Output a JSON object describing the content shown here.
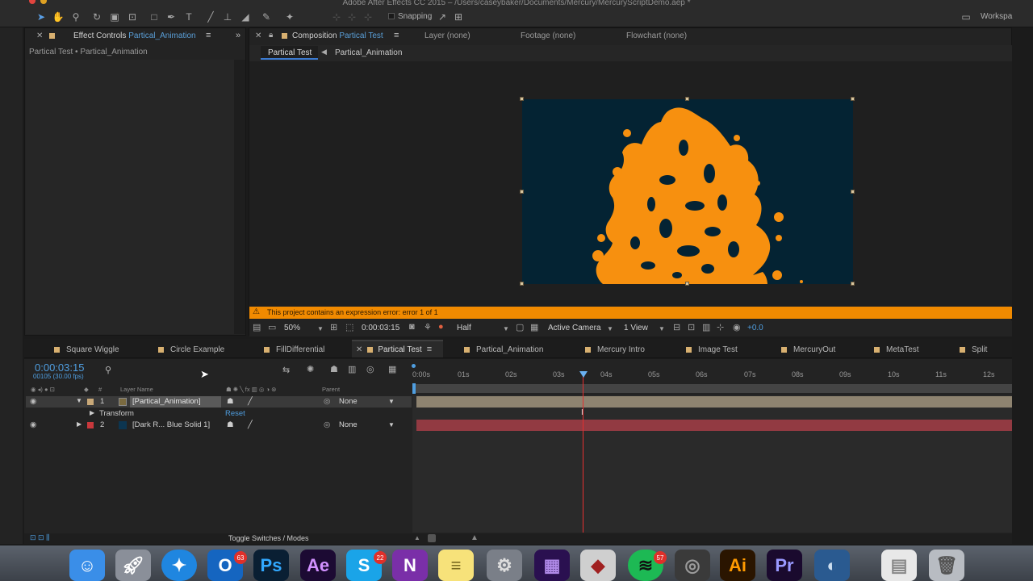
{
  "window": {
    "title": "Adobe After Effects CC 2015 – /Users/caseybaker/Documents/Mercury/MercuryScriptDemo.aep *"
  },
  "toolbar": {
    "tools": [
      "selection-tool",
      "hand-tool",
      "zoom-tool",
      "rotation-tool",
      "camera-tool",
      "behind-tool",
      "shape-tool",
      "pen-tool",
      "type-tool",
      "brush-tool",
      "clone-stamp-tool",
      "eraser-tool",
      "roto-brush-tool",
      "puppet-tool"
    ],
    "snapping_label": "Snapping",
    "workspace_label": "Workspa"
  },
  "effect_controls": {
    "tab_title": "Effect Controls",
    "tab_layer": "Partical_Animation",
    "breadcrumb": "Partical Test • Partical_Animation"
  },
  "composition": {
    "tab_title": "Composition",
    "tab_comp": "Partical Test",
    "other_tabs": [
      "Layer (none)",
      "Footage (none)",
      "Flowchart (none)"
    ],
    "breadcrumbs": [
      "Partical Test",
      "Partical_Animation"
    ],
    "error_message": "This project contains an expression error: error 1 of 1",
    "zoom": "50%",
    "timecode": "0:00:03:15",
    "resolution": "Half",
    "camera": "Active Camera",
    "views": "1 View",
    "exposure": "+0.0",
    "canvas_color": "#042333",
    "particle_color": "#f7900f"
  },
  "timeline": {
    "tabs": [
      "Square Wiggle",
      "Circle Example",
      "FillDifferential",
      "Partical Test",
      "Partical_Animation",
      "Mercury Intro",
      "Image Test",
      "MercuryOut",
      "MetaTest",
      "Split"
    ],
    "active_tab": "Partical Test",
    "timecode": "0:00:03:15",
    "frames": "00105 (30.00 fps)",
    "ruler_ticks": [
      "0:00s",
      "01s",
      "02s",
      "03s",
      "04s",
      "05s",
      "06s",
      "07s",
      "08s",
      "09s",
      "10s",
      "11s",
      "12s"
    ],
    "column_layer_name": "Layer Name",
    "column_parent": "Parent",
    "column_hash": "#",
    "layers": [
      {
        "index": "1",
        "name": "[Partical_Animation]",
        "parent": "None",
        "label_color": "#c8a878"
      },
      {
        "index": "2",
        "name": "[Dark R... Blue Solid 1]",
        "parent": "None",
        "label_color": "#c8383c"
      }
    ],
    "transform_label": "Transform",
    "reset_label": "Reset",
    "toggle_label": "Toggle Switches / Modes"
  },
  "dock": {
    "apps": [
      "Finder",
      "Launchpad",
      "Safari",
      "Outlook",
      "Photoshop",
      "After Effects",
      "Skype",
      "OneNote",
      "Notes",
      "System Preferences",
      "Media Encoder",
      "Mercury",
      "Spotify",
      "Audio",
      "Illustrator",
      "Premiere",
      "Browser",
      "Documents",
      "Trash"
    ],
    "badge_outlook": "63",
    "badge_skype": "22",
    "badge_spotify": "57"
  }
}
